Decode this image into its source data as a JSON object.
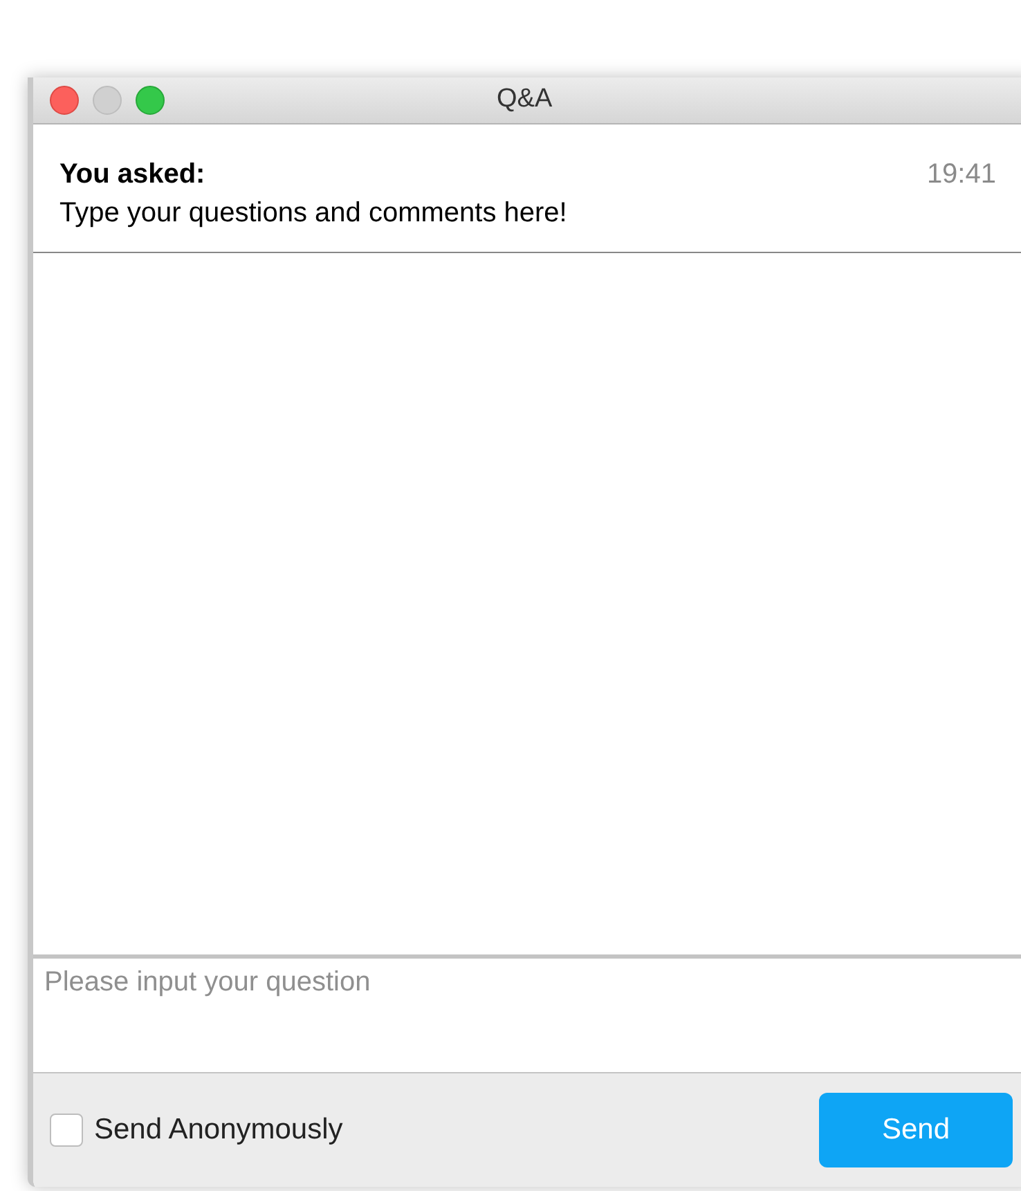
{
  "window": {
    "title": "Q&A"
  },
  "messages": [
    {
      "author": "You asked:",
      "time": "19:41",
      "text": "Type your questions and comments here!"
    }
  ],
  "question_input": {
    "placeholder": "Please input your question"
  },
  "anonymous": {
    "label": "Send Anonymously",
    "checked": false
  },
  "send_button": {
    "label": "Send"
  }
}
